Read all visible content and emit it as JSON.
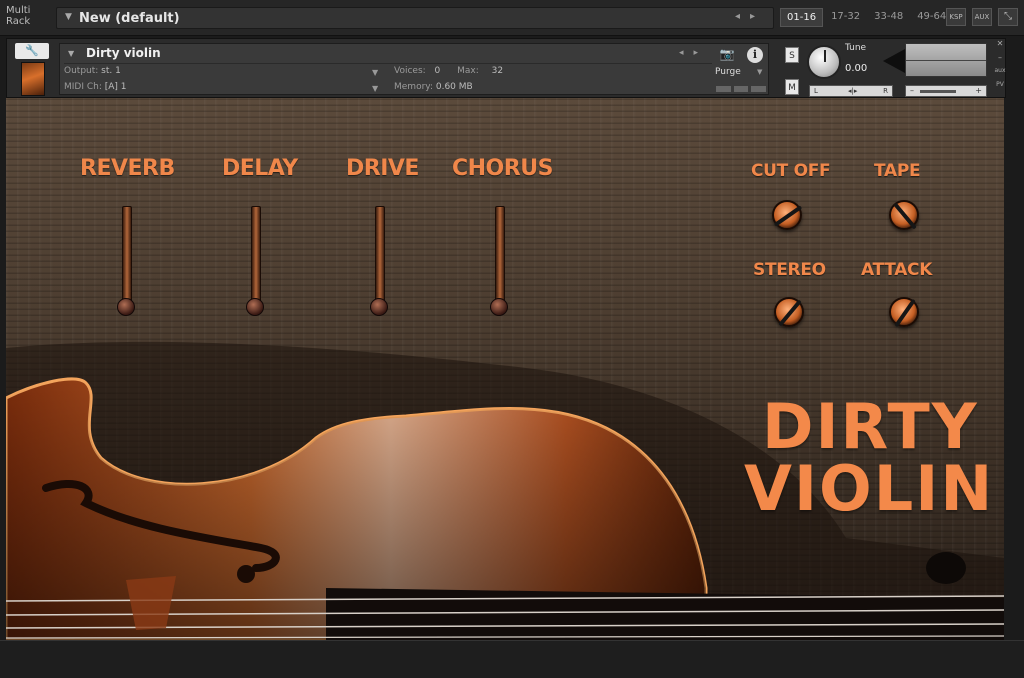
{
  "rack": {
    "label_line1": "Multi",
    "label_line2": "Rack",
    "name": "New (default)",
    "pages": [
      "01-16",
      "17-32",
      "33-48",
      "49-64"
    ],
    "active_page": "01-16",
    "buttons": [
      "KSP",
      "AUX"
    ]
  },
  "instrument": {
    "name": "Dirty violin",
    "output_label": "Output:",
    "output_value": "st. 1",
    "midi_label": "MIDI Ch:",
    "midi_value": "[A]  1",
    "voices_label": "Voices:",
    "voices_value": "0",
    "max_label": "Max:",
    "max_value": "32",
    "memory_label": "Memory:",
    "memory_value": "0.60 MB",
    "purge_label": "Purge",
    "solo_label": "S",
    "mute_label": "M",
    "tune_label": "Tune",
    "tune_value": "0.00",
    "pan_left": "L",
    "pan_right": "R",
    "aux_label": "aux",
    "pv_label": "PV"
  },
  "effects": {
    "faders": [
      {
        "label": "REVERB"
      },
      {
        "label": "DELAY"
      },
      {
        "label": "DRIVE"
      },
      {
        "label": "CHORUS"
      }
    ],
    "knobs": [
      {
        "label": "CUT OFF"
      },
      {
        "label": "TAPE"
      },
      {
        "label": "STEREO"
      },
      {
        "label": "ATTACK"
      }
    ]
  },
  "title": {
    "line1": "DIRTY",
    "line2": "VIOLIN"
  },
  "colors": {
    "accent": "#f0874a",
    "header_bg": "#2b2b2b",
    "wood_dark": "#2a211a"
  },
  "icons": [
    "wrench-icon",
    "camera-icon",
    "info-icon",
    "caret-down-icon",
    "arrow-left-icon",
    "arrow-right-icon"
  ]
}
